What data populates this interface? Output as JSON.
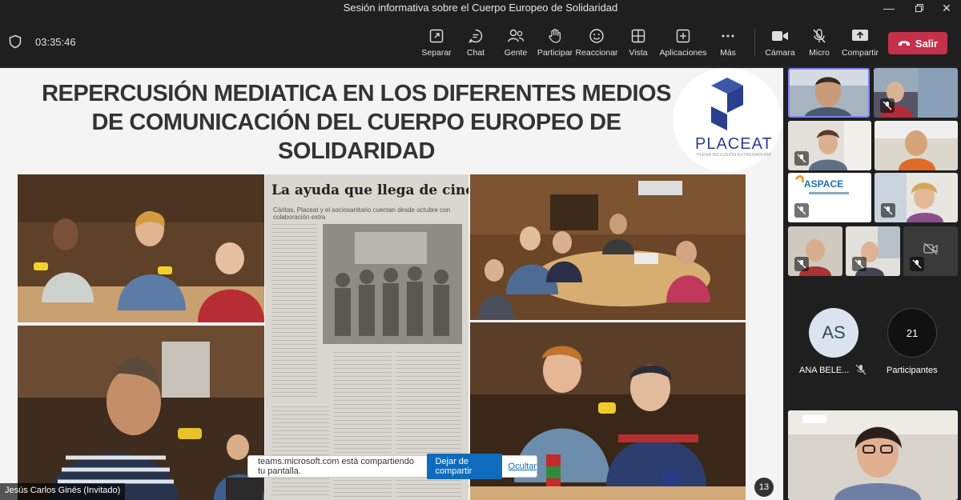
{
  "window": {
    "title": "Sesión informativa sobre el Cuerpo Europeo de Solidaridad"
  },
  "toolbar": {
    "timer": "03:35:46",
    "buttons": [
      {
        "label": "Separar",
        "icon": "pop-out-icon"
      },
      {
        "label": "Chat",
        "icon": "chat-icon"
      },
      {
        "label": "Gente",
        "icon": "people-icon"
      },
      {
        "label": "Participar",
        "icon": "raise-hand-icon"
      },
      {
        "label": "Reaccionar",
        "icon": "emoji-icon"
      },
      {
        "label": "Vista",
        "icon": "grid-view-icon"
      },
      {
        "label": "Aplicaciones",
        "icon": "apps-icon"
      },
      {
        "label": "Más",
        "icon": "more-icon"
      },
      {
        "label": "Cámara",
        "icon": "camera-icon"
      },
      {
        "label": "Micro",
        "icon": "mic-off-icon"
      },
      {
        "label": "Compartir",
        "icon": "share-icon"
      }
    ],
    "leave_label": "Salir",
    "leave_color": "#c4314b"
  },
  "slide": {
    "title": "REPERCUSIÓN MEDIATICA EN LOS DIFERENTES MEDIOS DE COMUNICACIÓN  DEL CUERPO EUROPEO DE SOLIDARIDAD",
    "logo_text": "PLACEAT",
    "logo_sub": "PLENA INCLUSIÓN EXTREMADURA",
    "press_headline": "La ayuda que llega de cinco países",
    "press_sub": "Cáritas, Placeat y el sociosanitario cuentan desde octubre con colaboración extra",
    "page_number": "13"
  },
  "share_notice": {
    "message": "teams.microsoft.com está compartiendo tu pantalla.",
    "stop_label": "Dejar de compartir",
    "hide_label": "Ocultar"
  },
  "presenter": {
    "name": "Jesús Carlos Ginés (Invitado)"
  },
  "participants": {
    "avatar_initials": "AS",
    "avatar_name": "ANA BELE...",
    "count": "21",
    "count_label": "Participantes"
  }
}
